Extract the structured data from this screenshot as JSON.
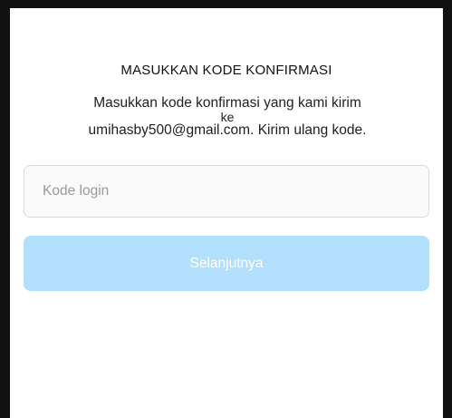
{
  "dialog": {
    "title": "MASUKKAN KODE KONFIRMASI",
    "message_line1": "Masukkan kode konfirmasi yang kami kirim",
    "message_line2": "ke",
    "message_email": "umihasby500@gmail.com.",
    "message_resend": " Kirim ulang kode."
  },
  "code_field": {
    "placeholder": "Kode login",
    "value": ""
  },
  "next_button": {
    "label": "Selanjutnya",
    "enabled": false
  },
  "colors": {
    "button_disabled": "#b2dffc",
    "frame_border": "#111111"
  }
}
